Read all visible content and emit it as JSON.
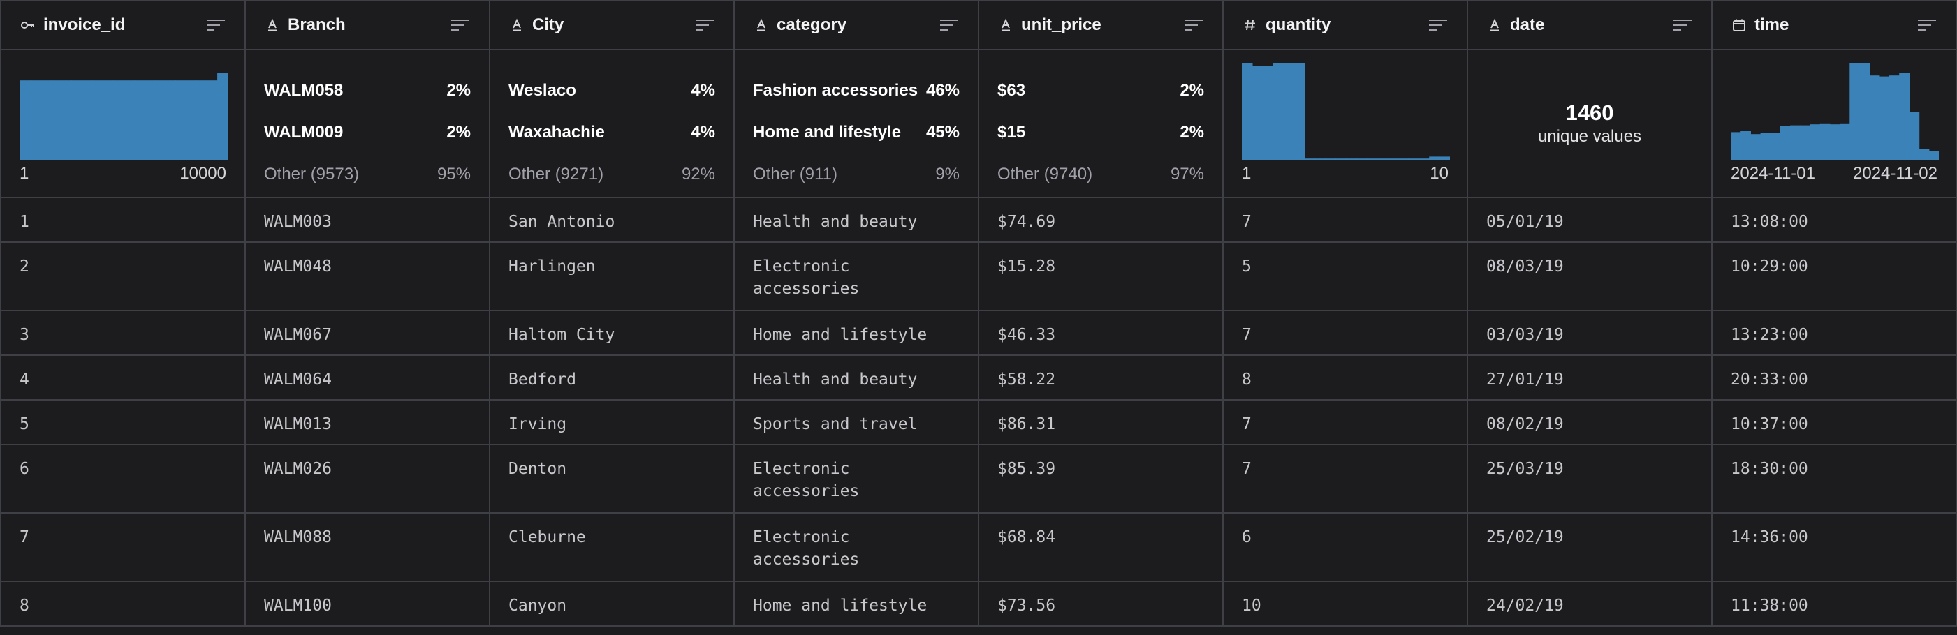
{
  "columns": [
    {
      "name": "invoice_id",
      "type_icon": "key-icon"
    },
    {
      "name": "Branch",
      "type_icon": "text-type-icon"
    },
    {
      "name": "City",
      "type_icon": "text-type-icon"
    },
    {
      "name": "category",
      "type_icon": "text-type-icon"
    },
    {
      "name": "unit_price",
      "type_icon": "text-type-icon"
    },
    {
      "name": "quantity",
      "type_icon": "hash-icon"
    },
    {
      "name": "date",
      "type_icon": "text-type-icon"
    },
    {
      "name": "time",
      "type_icon": "calendar-icon"
    }
  ],
  "summary": {
    "invoice_id": {
      "histogram": [
        0.82,
        0.82,
        0.82,
        0.82,
        0.82,
        0.82,
        0.82,
        0.82,
        0.82,
        0.82,
        0.82,
        0.82,
        0.82,
        0.82,
        0.82,
        0.82,
        0.82,
        0.82,
        0.82,
        0.9
      ],
      "min_label": "1",
      "max_label": "10000"
    },
    "Branch": {
      "top": [
        {
          "label": "WALM058",
          "pct": "2%"
        },
        {
          "label": "WALM009",
          "pct": "2%"
        }
      ],
      "other": {
        "label": "Other (9573)",
        "pct": "95%"
      }
    },
    "City": {
      "top": [
        {
          "label": "Weslaco",
          "pct": "4%"
        },
        {
          "label": "Waxahachie",
          "pct": "4%"
        }
      ],
      "other": {
        "label": "Other (9271)",
        "pct": "92%"
      }
    },
    "category": {
      "top": [
        {
          "label": "Fashion accessories",
          "pct": "46%"
        },
        {
          "label": "Home and lifestyle",
          "pct": "45%"
        }
      ],
      "other": {
        "label": "Other (911)",
        "pct": "9%"
      }
    },
    "unit_price": {
      "top": [
        {
          "label": "$63",
          "pct": "2%"
        },
        {
          "label": "$15",
          "pct": "2%"
        }
      ],
      "other": {
        "label": "Other (9740)",
        "pct": "97%"
      }
    },
    "quantity": {
      "histogram": [
        1.0,
        0.97,
        0.97,
        1.0,
        1.0,
        1.0,
        0.02,
        0.02,
        0.02,
        0.02,
        0.02,
        0.02,
        0.02,
        0.02,
        0.02,
        0.02,
        0.02,
        0.02,
        0.04,
        0.04
      ],
      "min_label": "1",
      "max_label": "10"
    },
    "date": {
      "unique_count": "1460",
      "unique_label": "unique values"
    },
    "time": {
      "histogram": [
        0.29,
        0.3,
        0.27,
        0.28,
        0.28,
        0.35,
        0.36,
        0.36,
        0.37,
        0.38,
        0.37,
        0.38,
        1.0,
        1.0,
        0.87,
        0.86,
        0.87,
        0.9,
        0.5,
        0.12,
        0.1
      ],
      "min_label": "2024-11-01",
      "max_label": "2024-11-02"
    }
  },
  "rows": [
    [
      "1",
      "WALM003",
      "San Antonio",
      "Health and beauty",
      "$74.69",
      "7",
      "05/01/19",
      "13:08:00"
    ],
    [
      "2",
      "WALM048",
      "Harlingen",
      "Electronic accessories",
      "$15.28",
      "5",
      "08/03/19",
      "10:29:00"
    ],
    [
      "3",
      "WALM067",
      "Haltom City",
      "Home and lifestyle",
      "$46.33",
      "7",
      "03/03/19",
      "13:23:00"
    ],
    [
      "4",
      "WALM064",
      "Bedford",
      "Health and beauty",
      "$58.22",
      "8",
      "27/01/19",
      "20:33:00"
    ],
    [
      "5",
      "WALM013",
      "Irving",
      "Sports and travel",
      "$86.31",
      "7",
      "08/02/19",
      "10:37:00"
    ],
    [
      "6",
      "WALM026",
      "Denton",
      "Electronic accessories",
      "$85.39",
      "7",
      "25/03/19",
      "18:30:00"
    ],
    [
      "7",
      "WALM088",
      "Cleburne",
      "Electronic accessories",
      "$68.84",
      "6",
      "25/02/19",
      "14:36:00"
    ],
    [
      "8",
      "WALM100",
      "Canyon",
      "Home and lifestyle",
      "$73.56",
      "10",
      "24/02/19",
      "11:38:00"
    ]
  ],
  "colors": {
    "bar": "#3b82b8",
    "grid_line": "#3f3f46",
    "background": "#1c1c1f"
  }
}
